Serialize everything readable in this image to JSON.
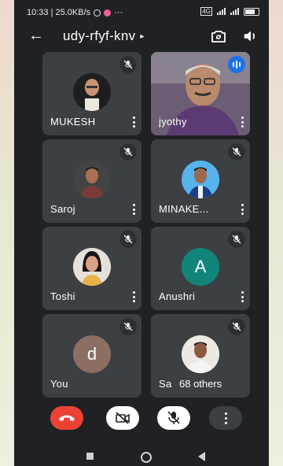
{
  "status_bar": {
    "time_speed": "10:33 | 25.0KB/s",
    "overflow": "···"
  },
  "meeting": {
    "code": "udy-rfyf-knv",
    "back_icon": "arrow-left-icon",
    "caret": "▸"
  },
  "participants": [
    {
      "name": "MUKESH",
      "avatar": "photo",
      "muted": true
    },
    {
      "name": "jyothy",
      "avatar": "video",
      "muted": false,
      "speaking": true
    },
    {
      "name": "Saroj",
      "avatar": "photo",
      "muted": true
    },
    {
      "name": "MINAKE...",
      "avatar": "photo",
      "muted": true
    },
    {
      "name": "Toshi",
      "avatar": "photo",
      "muted": true
    },
    {
      "name": "Anushri",
      "avatar": "letter",
      "letter": "A",
      "color": "#12857a",
      "muted": true
    },
    {
      "name": "You",
      "avatar": "letter",
      "letter": "d",
      "color": "#8d6e63",
      "muted": true
    },
    {
      "name": "Sa",
      "avatar": "photo",
      "muted": true,
      "others_label": "68 others"
    }
  ],
  "controls": {
    "end_call_color": "#ea4335",
    "buttons": [
      "end-call",
      "camera-off",
      "mic-off",
      "more-options"
    ]
  },
  "colors": {
    "background": "#202124",
    "tile": "#3c4043",
    "accent": "#1a73e8"
  }
}
